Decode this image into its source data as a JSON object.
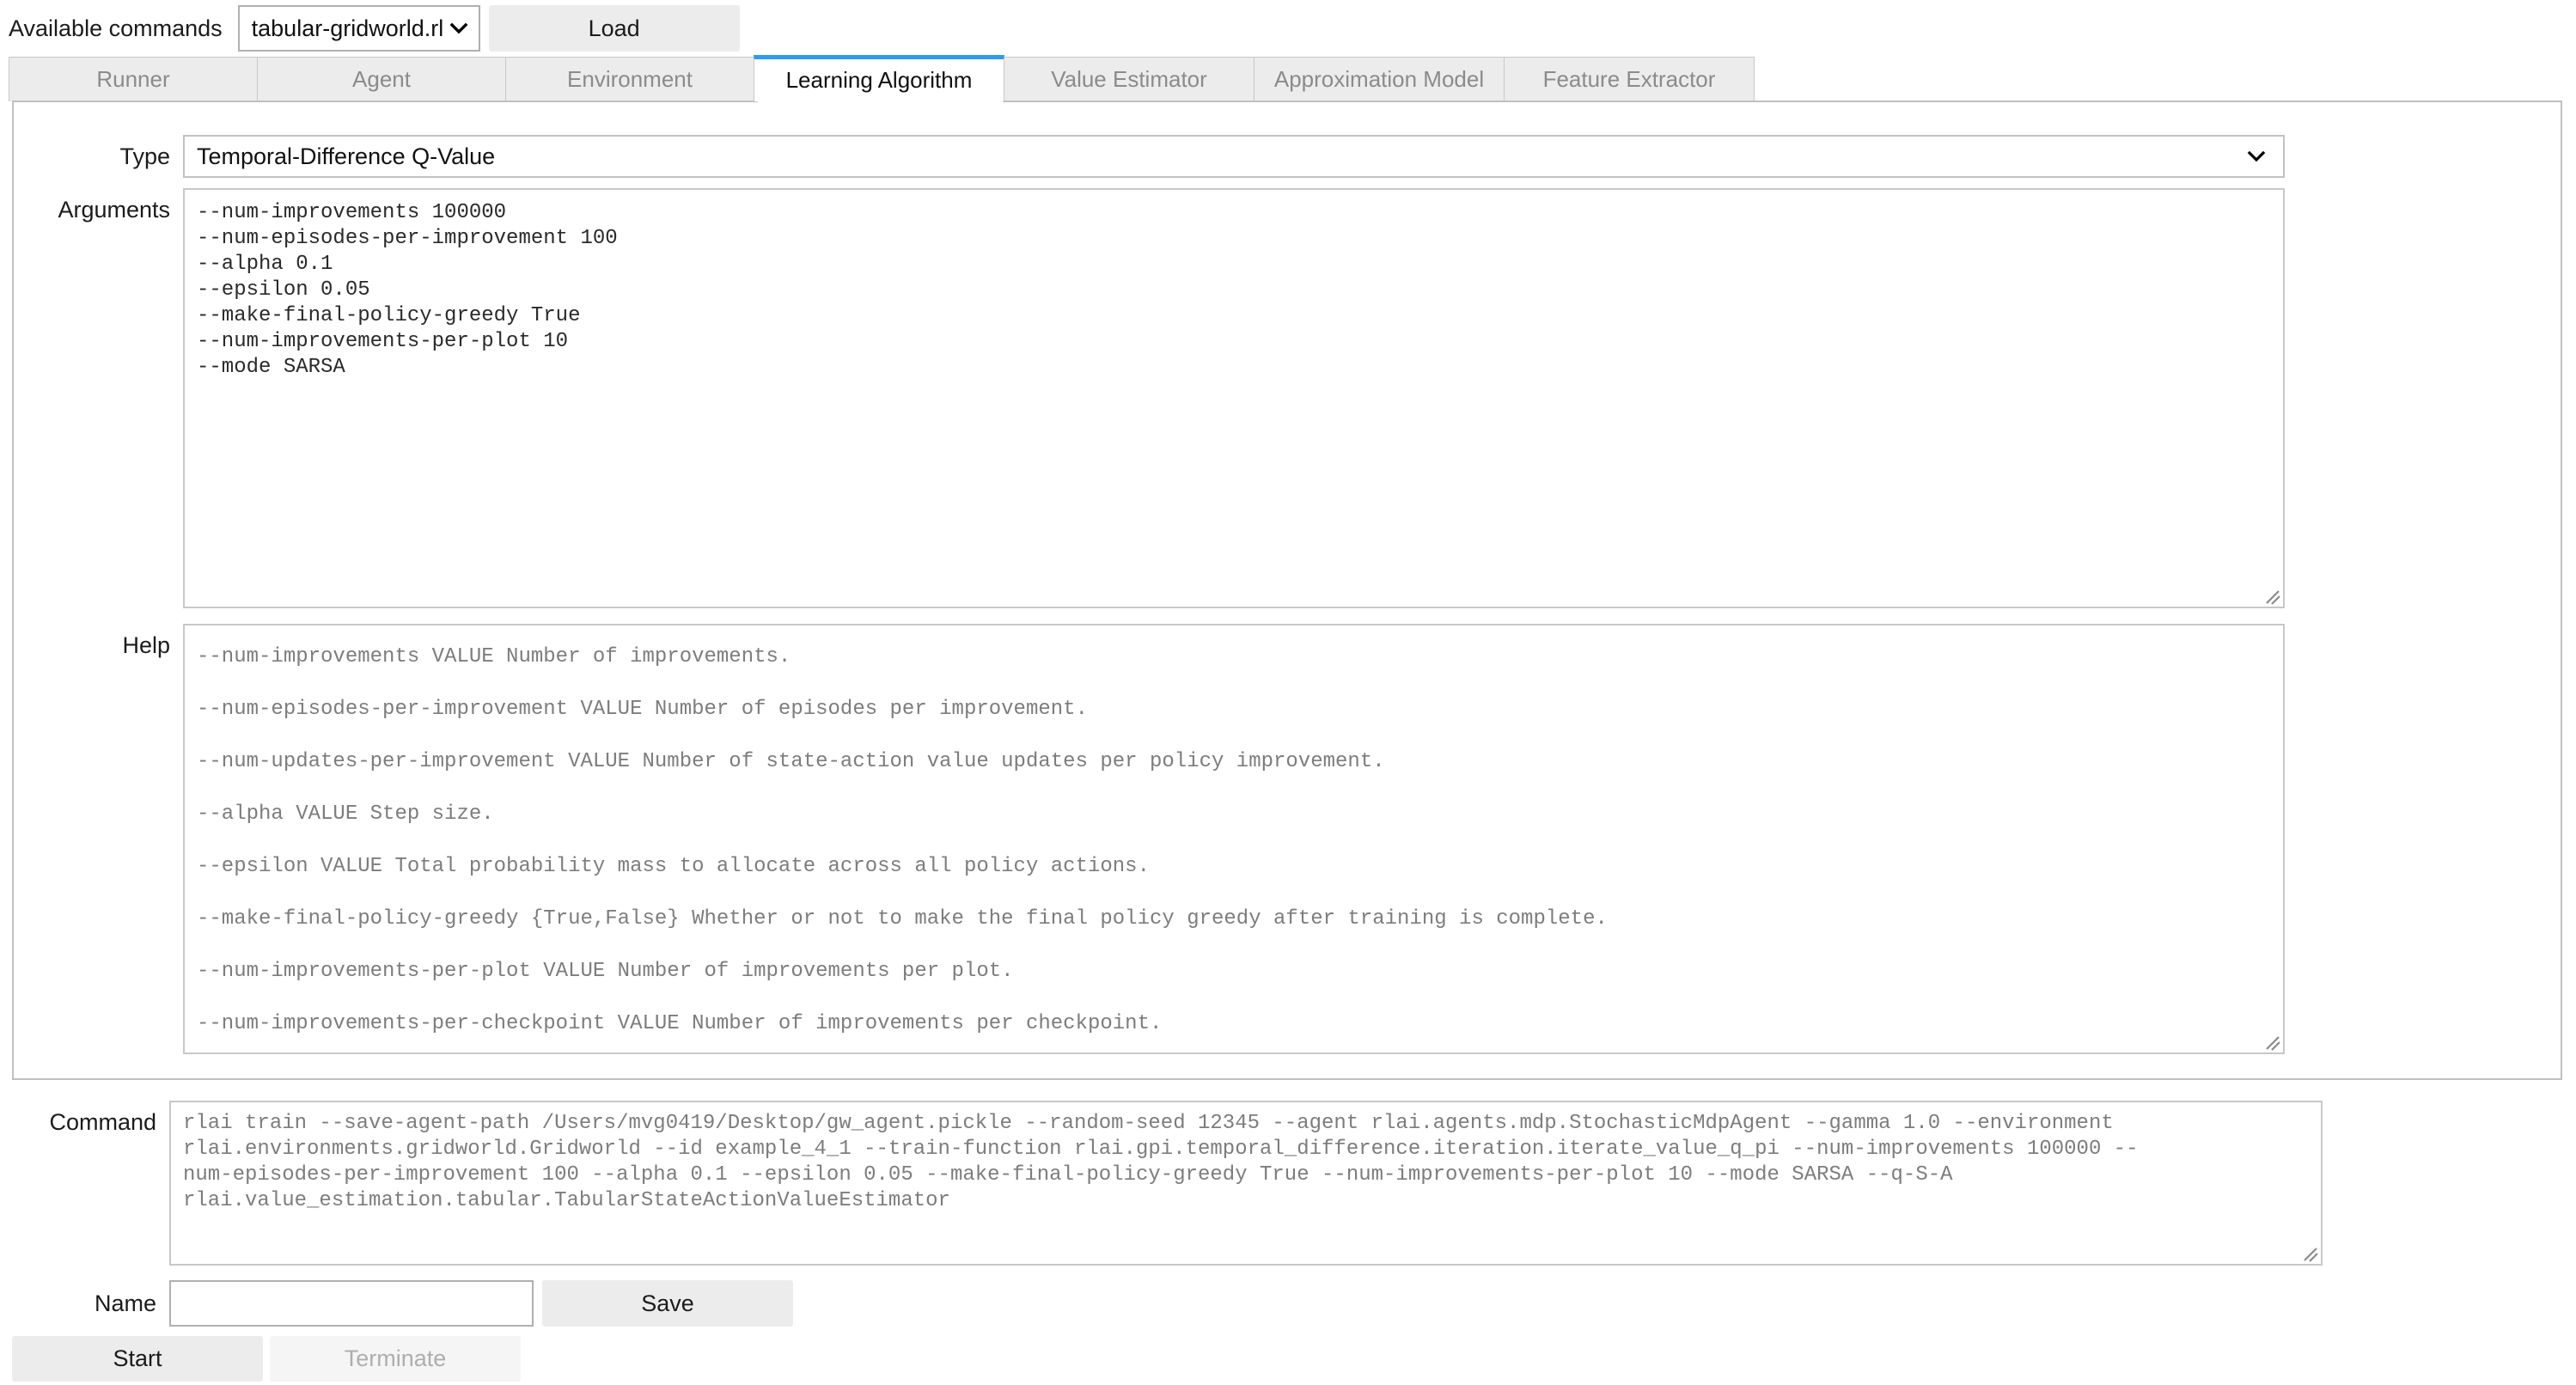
{
  "topbar": {
    "label": "Available commands",
    "selected_command": "tabular-gridworld.rlai",
    "load_label": "Load"
  },
  "tabs": [
    {
      "label": "Runner",
      "active": false
    },
    {
      "label": "Agent",
      "active": false
    },
    {
      "label": "Environment",
      "active": false
    },
    {
      "label": "Learning Algorithm",
      "active": true
    },
    {
      "label": "Value Estimator",
      "active": false
    },
    {
      "label": "Approximation Model",
      "active": false
    },
    {
      "label": "Feature Extractor",
      "active": false
    }
  ],
  "form": {
    "type_label": "Type",
    "type_value": "Temporal-Difference Q-Value",
    "arguments_label": "Arguments",
    "arguments_value": "--num-improvements 100000\n--num-episodes-per-improvement 100\n--alpha 0.1\n--epsilon 0.05\n--make-final-policy-greedy True\n--num-improvements-per-plot 10\n--mode SARSA",
    "help_label": "Help",
    "help_value": "--num-improvements VALUE Number of improvements.\n--num-episodes-per-improvement VALUE Number of episodes per improvement.\n--num-updates-per-improvement VALUE Number of state-action value updates per policy improvement.\n--alpha VALUE Step size.\n--epsilon VALUE Total probability mass to allocate across all policy actions.\n--make-final-policy-greedy {True,False} Whether or not to make the final policy greedy after training is complete.\n--num-improvements-per-plot VALUE Number of improvements per plot.\n--num-improvements-per-checkpoint VALUE Number of improvements per checkpoint."
  },
  "command": {
    "label": "Command",
    "value": "rlai train --save-agent-path /Users/mvg0419/Desktop/gw_agent.pickle --random-seed 12345 --agent rlai.agents.mdp.StochasticMdpAgent --gamma 1.0 --environment\nrlai.environments.gridworld.Gridworld --id example_4_1 --train-function rlai.gpi.temporal_difference.iteration.iterate_value_q_pi --num-improvements 100000 --\nnum-episodes-per-improvement 100 --alpha 0.1 --epsilon 0.05 --make-final-policy-greedy True --num-improvements-per-plot 10 --mode SARSA --q-S-A\nrlai.value_estimation.tabular.TabularStateActionValueEstimator"
  },
  "name_row": {
    "label": "Name",
    "value": "",
    "placeholder": "",
    "save_label": "Save"
  },
  "run_row": {
    "start_label": "Start",
    "terminate_label": "Terminate"
  },
  "colors": {
    "active_tab_accent": "#2e9bf0",
    "button_bg": "#ececec",
    "disabled_text": "#aeaeae",
    "helper_text": "#7d7d7d"
  }
}
